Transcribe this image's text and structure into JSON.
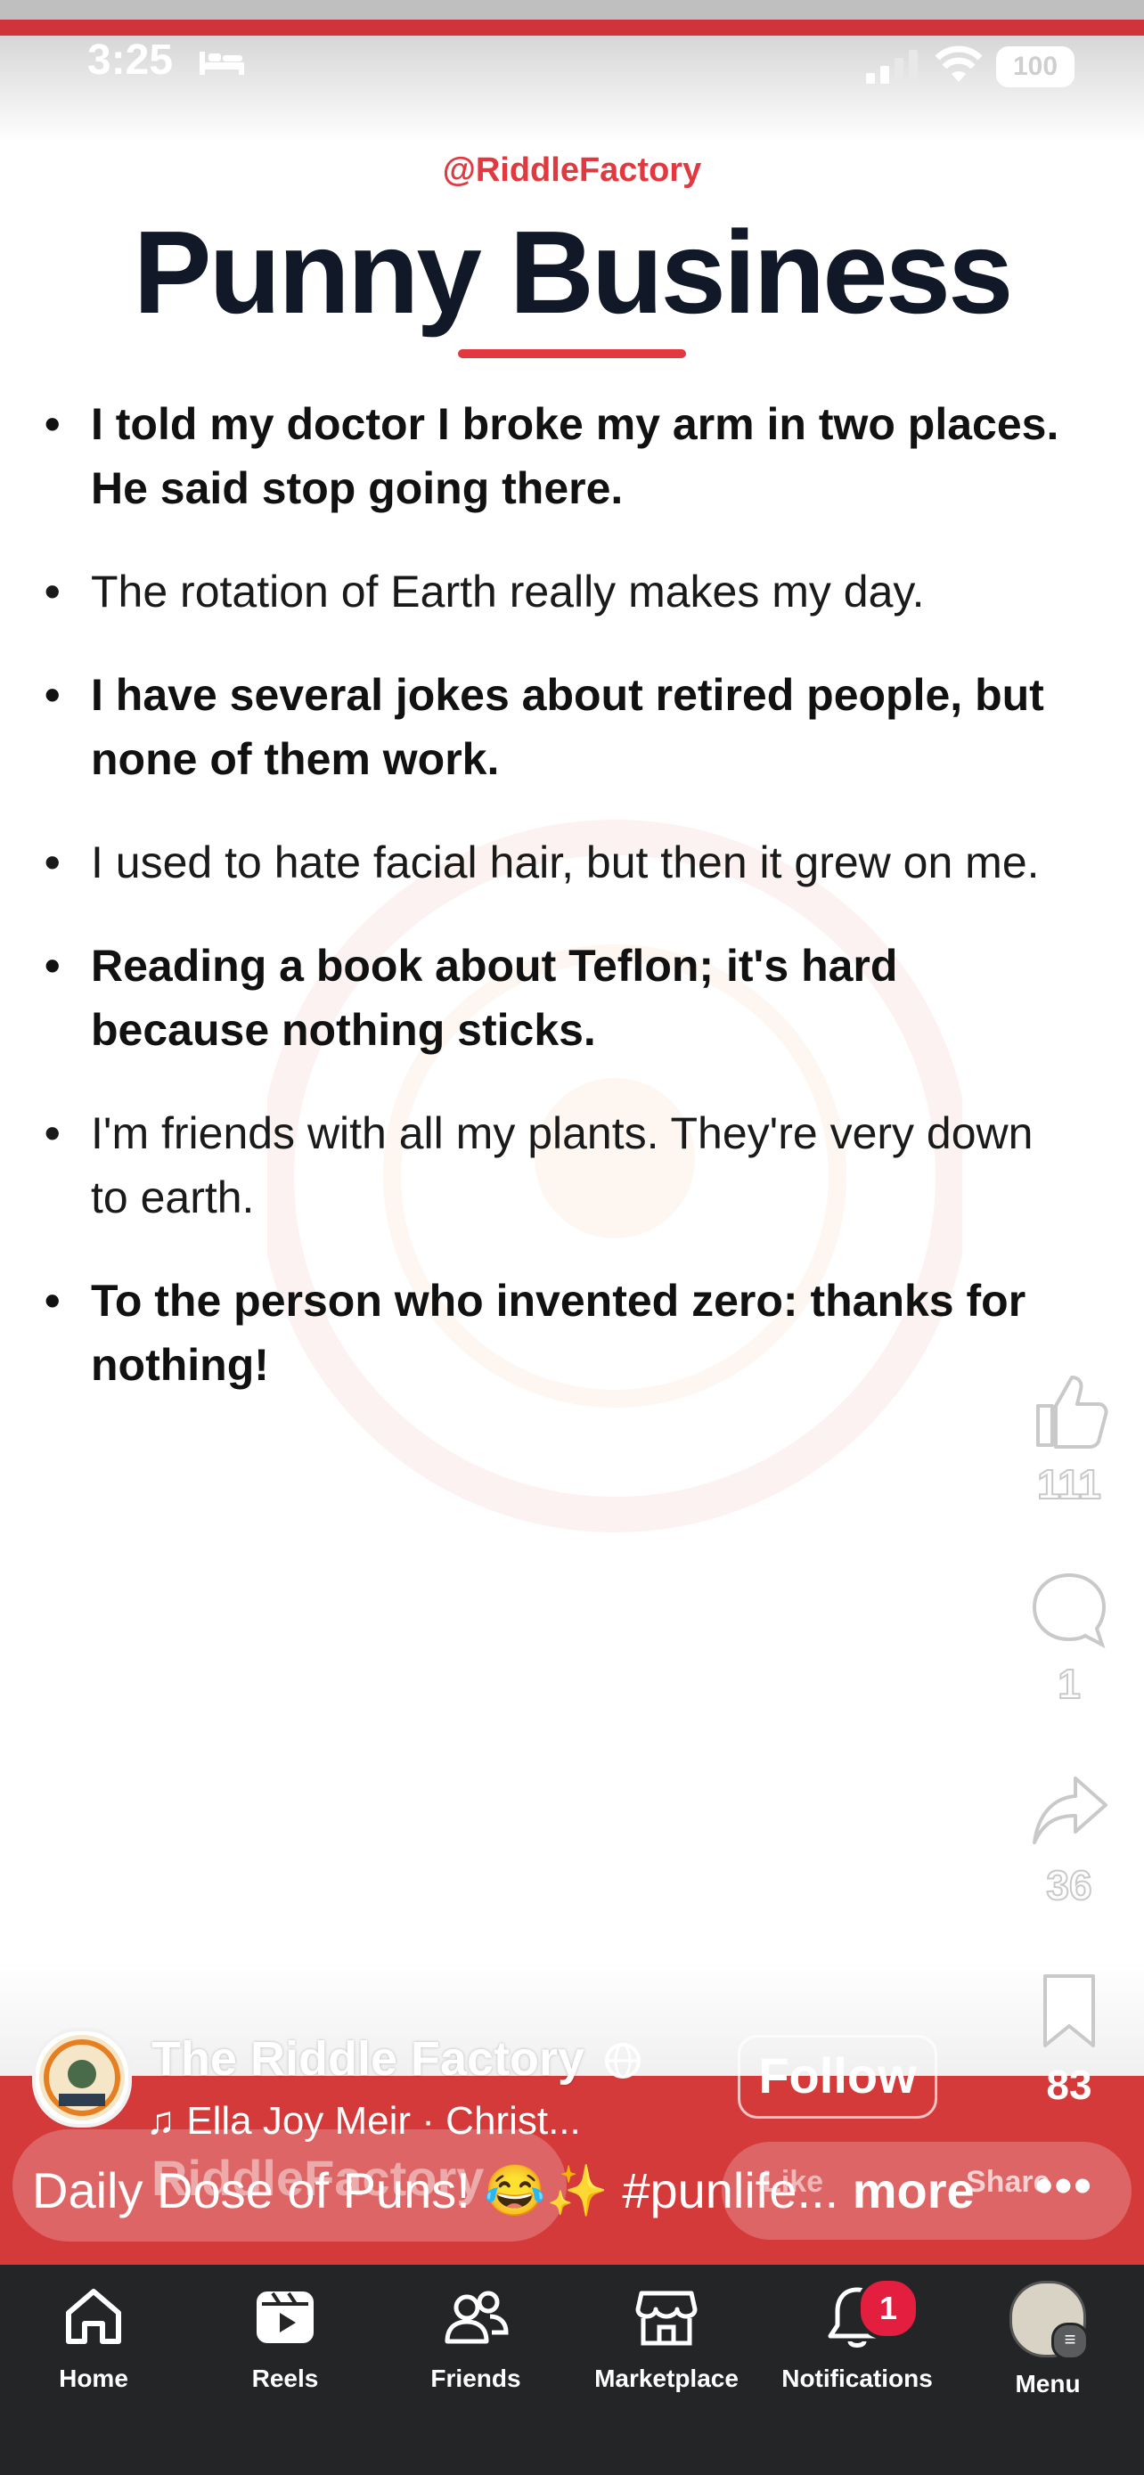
{
  "status": {
    "time": "3:25",
    "battery": "100"
  },
  "post": {
    "handle": "@RiddleFactory",
    "title": "Punny Business",
    "puns": [
      "I told my doctor I broke my arm in two places. He said stop going there.",
      "The rotation of Earth really makes my day.",
      "I have several jokes about retired people, but none of them work.",
      "I used to hate facial hair, but then it grew on me.",
      "Reading a book about Teflon; it's hard because nothing sticks.",
      "I'm friends with all my plants. They're very down to earth.",
      "To the person who invented zero: thanks for nothing!"
    ]
  },
  "actions": {
    "likes": "111",
    "comments": "1",
    "shares": "36",
    "saves": "83"
  },
  "reel": {
    "page_name": "The Riddle Factory",
    "follow_label": "Follow",
    "music": "Ella Joy Meir · Christ...",
    "ghost_name": "RiddleFactory",
    "ghost_like": "Like",
    "ghost_share": "Share",
    "caption": "Daily Dose of Puns! 😂✨ #punlife...",
    "caption_more": "more"
  },
  "nav": {
    "items": [
      {
        "label": "Home",
        "icon": "home-icon"
      },
      {
        "label": "Reels",
        "icon": "reels-icon"
      },
      {
        "label": "Friends",
        "icon": "friends-icon"
      },
      {
        "label": "Marketplace",
        "icon": "marketplace-icon"
      },
      {
        "label": "Notifications",
        "icon": "bell-icon"
      },
      {
        "label": "Menu",
        "icon": "profile-avatar"
      }
    ],
    "notification_badge": "1"
  },
  "colors": {
    "accent": "#e2383f",
    "band": "#d43a3a",
    "navbar": "#242526"
  }
}
